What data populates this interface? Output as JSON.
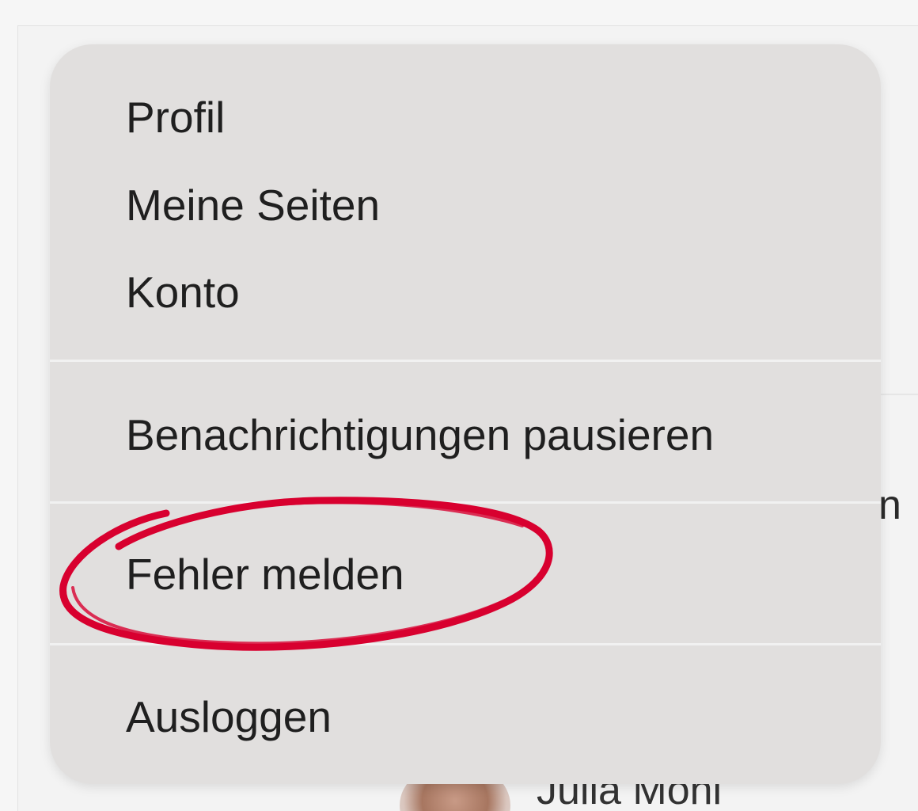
{
  "menu": {
    "items": [
      {
        "label": "Profil"
      },
      {
        "label": "Meine Seiten"
      },
      {
        "label": "Konto"
      },
      {
        "label": "Benachrichtigungen pausieren"
      },
      {
        "label": "Fehler melden"
      },
      {
        "label": "Ausloggen"
      }
    ]
  },
  "background": {
    "person_name": "Julia Möhl",
    "partial_glyph": "n"
  },
  "colors": {
    "menu_bg": "#e1dfde",
    "annotation": "#d8002f",
    "text": "#1f1f1f"
  }
}
